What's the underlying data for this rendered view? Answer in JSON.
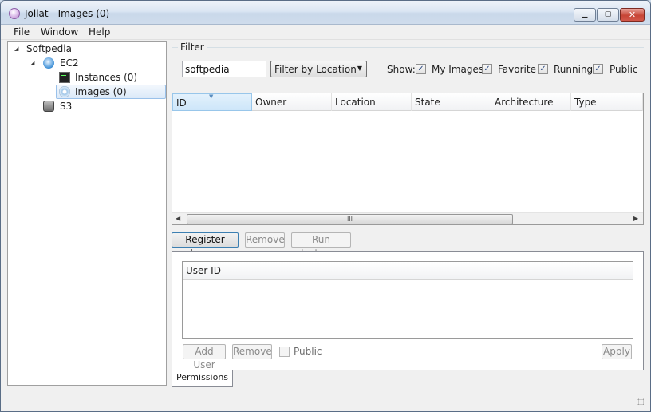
{
  "window": {
    "title": "Jollat - Images (0)"
  },
  "menu": [
    "File",
    "Window",
    "Help"
  ],
  "tree": {
    "root": "Softpedia",
    "ec2": "EC2",
    "instances": "Instances (0)",
    "images": "Images (0)",
    "s3": "S3"
  },
  "filter": {
    "legend": "Filter",
    "search_value": "softpedia",
    "select_value": "Filter by Location",
    "show_label": "Show:",
    "checkboxes": [
      {
        "label": "My Images",
        "checked": true
      },
      {
        "label": "Favorite",
        "checked": true
      },
      {
        "label": "Running",
        "checked": true
      },
      {
        "label": "Public",
        "checked": true
      }
    ]
  },
  "images_table": {
    "columns": [
      "ID",
      "Owner",
      "Location",
      "State",
      "Architecture",
      "Type"
    ],
    "rows": [],
    "scroll_grip": "III"
  },
  "actions": {
    "register": "Register Image",
    "remove": "Remove",
    "run": "Run Instance"
  },
  "permissions": {
    "column": "User ID",
    "add_user": "Add User",
    "remove": "Remove",
    "public_label": "Public",
    "public_checked": false,
    "apply": "Apply",
    "tab": "Permissions"
  }
}
